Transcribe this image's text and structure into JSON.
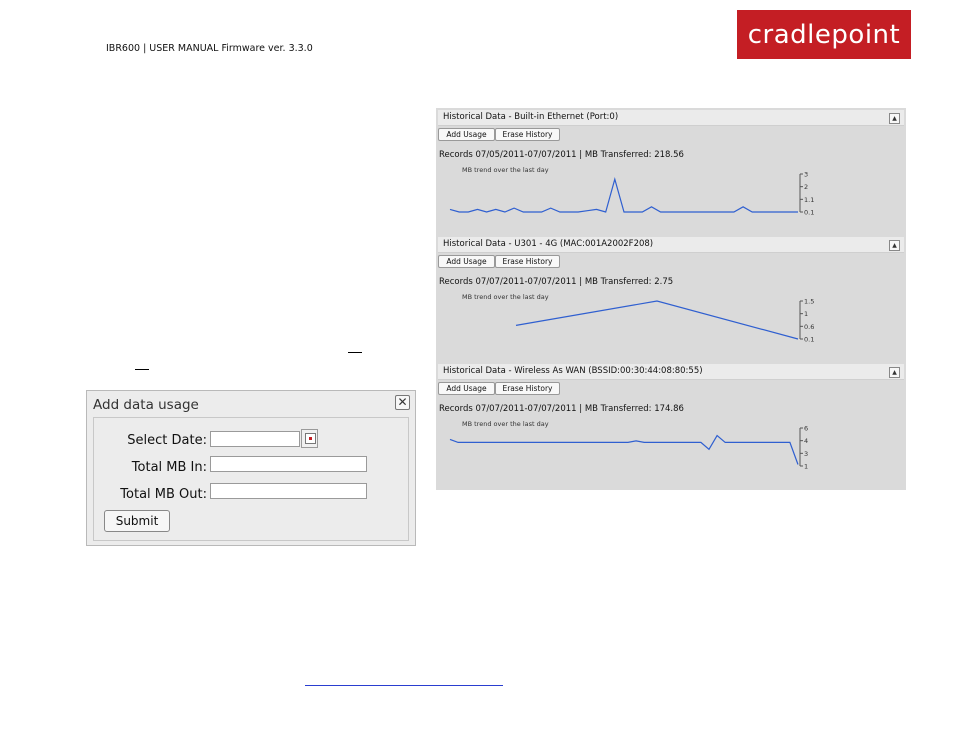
{
  "header": {
    "manual_text": "IBR600 | USER MANUAL Firmware ver. 3.3.0",
    "logo_text": "cradlepoint"
  },
  "dialog": {
    "title": "Add data usage",
    "close_glyph": "✕",
    "fields": [
      {
        "label": "Select Date:",
        "value": ""
      },
      {
        "label": "Total MB In:",
        "value": ""
      },
      {
        "label": "Total MB Out:",
        "value": ""
      }
    ],
    "submit_label": "Submit"
  },
  "history": {
    "add_usage_label": "Add Usage",
    "erase_history_label": "Erase History",
    "trend_label": "MB trend over the last day",
    "collapse_glyph": "▲",
    "panels": [
      {
        "title": "Historical Data - Built-in Ethernet (Port:0)",
        "records": "Records 07/05/2011-07/07/2011 | MB Transferred: 218.56"
      },
      {
        "title": "Historical Data - U301 - 4G (MAC:001A2002F208)",
        "records": "Records 07/07/2011-07/07/2011 | MB Transferred: 2.75"
      },
      {
        "title": "Historical Data - Wireless As WAN (BSSID:00:30:44:08:80:55)",
        "records": "Records 07/07/2011-07/07/2011 | MB Transferred: 174.86"
      }
    ]
  },
  "chart_data": [
    {
      "type": "line",
      "title": "MB trend over the last day",
      "y_ticks": [
        "3",
        "2",
        "1.1",
        "0.1"
      ],
      "ylim": [
        0.1,
        3
      ],
      "values": [
        0.3,
        0.1,
        0.1,
        0.3,
        0.1,
        0.3,
        0.1,
        0.4,
        0.1,
        0.1,
        0.1,
        0.4,
        0.1,
        0.1,
        0.1,
        0.2,
        0.3,
        0.1,
        2.6,
        0.1,
        0.1,
        0.1,
        0.5,
        0.1,
        0.1,
        0.1,
        0.1,
        0.1,
        0.1,
        0.1,
        0.1,
        0.1,
        0.5,
        0.1,
        0.1,
        0.1,
        0.1,
        0.1,
        0.1
      ]
    },
    {
      "type": "line",
      "title": "MB trend over the last day",
      "y_ticks": [
        "1.5",
        "1",
        "0.6",
        "0.1"
      ],
      "ylim": [
        0.1,
        1.5
      ],
      "values": [
        0.6,
        1.5,
        0.1
      ]
    },
    {
      "type": "line",
      "title": "MB trend over the last day",
      "y_ticks": [
        "6",
        "4",
        "3",
        "1"
      ],
      "ylim": [
        1,
        6
      ],
      "values": [
        4.5,
        4.1,
        4.1,
        4.1,
        4.1,
        4.1,
        4.1,
        4.1,
        4.1,
        4.1,
        4.1,
        4.1,
        4.1,
        4.1,
        4.1,
        4.1,
        4.1,
        4.1,
        4.1,
        4.1,
        4.1,
        4.1,
        4.1,
        4.3,
        4.1,
        4.1,
        4.1,
        4.1,
        4.1,
        4.1,
        4.1,
        4.1,
        3.2,
        5.0,
        4.1,
        4.1,
        4.1,
        4.1,
        4.1,
        4.1,
        4.1,
        4.1,
        4.1,
        1.2
      ]
    }
  ]
}
